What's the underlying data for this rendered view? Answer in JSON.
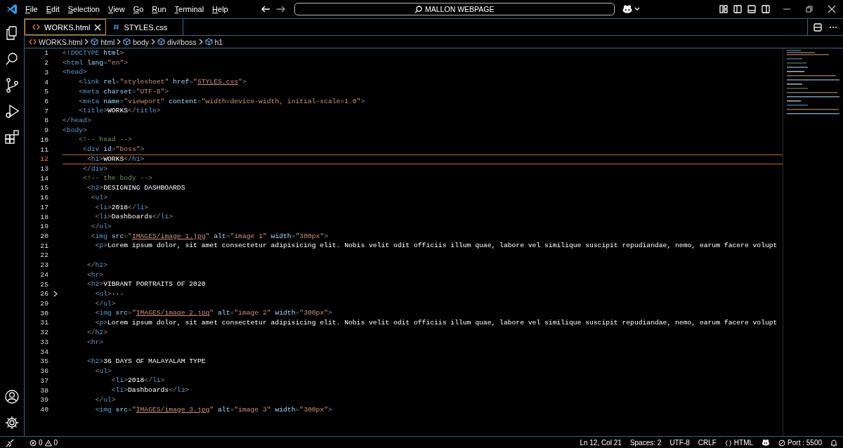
{
  "menu": [
    "File",
    "Edit",
    "Selection",
    "View",
    "Go",
    "Run",
    "Terminal",
    "Help"
  ],
  "search": {
    "value": "MALLON WEBPAGE"
  },
  "tabs": [
    {
      "label": "WORKS.html",
      "kind": "html",
      "selected": true
    },
    {
      "label": "STYLES.css",
      "kind": "css",
      "selected": false
    }
  ],
  "breadcrumb": [
    {
      "label": "WORKS.html",
      "kind": "file"
    },
    {
      "label": "html",
      "kind": "element"
    },
    {
      "label": "body",
      "kind": "element"
    },
    {
      "label": "div#boss",
      "kind": "element"
    },
    {
      "label": "h1",
      "kind": "element"
    }
  ],
  "lines": [
    {
      "number": "1",
      "current": false,
      "folded": false,
      "tokens": [
        {
          "kind": "p",
          "text": "<!"
        },
        {
          "kind": "t",
          "text": "DOCTYPE"
        },
        {
          "kind": "a",
          "text": " html"
        },
        {
          "kind": "p",
          "text": ">"
        }
      ]
    },
    {
      "number": "2",
      "current": false,
      "folded": false,
      "tokens": [
        {
          "kind": "p",
          "text": "<"
        },
        {
          "kind": "t",
          "text": "html"
        },
        {
          "kind": "a",
          "text": " lang"
        },
        {
          "kind": "p",
          "text": "="
        },
        {
          "kind": "s",
          "text": "\"en\""
        },
        {
          "kind": "p",
          "text": ">"
        }
      ]
    },
    {
      "number": "3",
      "current": false,
      "folded": false,
      "tokens": [
        {
          "kind": "p",
          "text": "<"
        },
        {
          "kind": "t",
          "text": "head"
        },
        {
          "kind": "p",
          "text": ">"
        }
      ]
    },
    {
      "number": "4",
      "current": false,
      "folded": false,
      "tokens": [
        {
          "kind": "p",
          "text": "    <"
        },
        {
          "kind": "t",
          "text": "link"
        },
        {
          "kind": "a",
          "text": " rel"
        },
        {
          "kind": "p",
          "text": "="
        },
        {
          "kind": "s",
          "text": "\"stylesheet\""
        },
        {
          "kind": "a",
          "text": " href"
        },
        {
          "kind": "p",
          "text": "="
        },
        {
          "kind": "s",
          "text": "\""
        },
        {
          "kind": "u",
          "text": "STYLES.css"
        },
        {
          "kind": "s",
          "text": "\""
        },
        {
          "kind": "p",
          "text": ">"
        }
      ]
    },
    {
      "number": "5",
      "current": false,
      "folded": false,
      "tokens": [
        {
          "kind": "p",
          "text": "    <"
        },
        {
          "kind": "t",
          "text": "meta"
        },
        {
          "kind": "a",
          "text": " charset"
        },
        {
          "kind": "p",
          "text": "="
        },
        {
          "kind": "s",
          "text": "\"UTF-8\""
        },
        {
          "kind": "p",
          "text": ">"
        }
      ]
    },
    {
      "number": "6",
      "current": false,
      "folded": false,
      "tokens": [
        {
          "kind": "p",
          "text": "    <"
        },
        {
          "kind": "t",
          "text": "meta"
        },
        {
          "kind": "a",
          "text": " name"
        },
        {
          "kind": "p",
          "text": "="
        },
        {
          "kind": "s",
          "text": "\"viewport\""
        },
        {
          "kind": "a",
          "text": " content"
        },
        {
          "kind": "p",
          "text": "="
        },
        {
          "kind": "s",
          "text": "\"width=device-width, initial-scale=1.0\""
        },
        {
          "kind": "p",
          "text": ">"
        }
      ]
    },
    {
      "number": "7",
      "current": false,
      "folded": false,
      "tokens": [
        {
          "kind": "p",
          "text": "    <"
        },
        {
          "kind": "t",
          "text": "title"
        },
        {
          "kind": "p",
          "text": ">"
        },
        {
          "kind": "x",
          "text": "WORKS"
        },
        {
          "kind": "p",
          "text": "</"
        },
        {
          "kind": "t",
          "text": "title"
        },
        {
          "kind": "p",
          "text": ">"
        }
      ]
    },
    {
      "number": "8",
      "current": false,
      "folded": false,
      "tokens": [
        {
          "kind": "p",
          "text": "</"
        },
        {
          "kind": "t",
          "text": "head"
        },
        {
          "kind": "p",
          "text": ">"
        }
      ]
    },
    {
      "number": "9",
      "current": false,
      "folded": false,
      "tokens": [
        {
          "kind": "p",
          "text": "<"
        },
        {
          "kind": "t",
          "text": "body"
        },
        {
          "kind": "p",
          "text": ">"
        }
      ]
    },
    {
      "number": "10",
      "current": false,
      "folded": false,
      "tokens": [
        {
          "kind": "c",
          "text": "    <!-- head -->"
        }
      ]
    },
    {
      "number": "11",
      "current": false,
      "folded": false,
      "tokens": [
        {
          "kind": "p",
          "text": "     <"
        },
        {
          "kind": "t",
          "text": "div"
        },
        {
          "kind": "a",
          "text": " id"
        },
        {
          "kind": "p",
          "text": "="
        },
        {
          "kind": "s",
          "text": "\"boss\""
        },
        {
          "kind": "p",
          "text": ">"
        }
      ]
    },
    {
      "number": "12",
      "current": true,
      "folded": false,
      "tokens": [
        {
          "kind": "p",
          "text": "      <"
        },
        {
          "kind": "t",
          "text": "h1"
        },
        {
          "kind": "p",
          "text": ">"
        },
        {
          "kind": "x",
          "text": "WORKS"
        },
        {
          "kind": "p",
          "text": "</"
        },
        {
          "kind": "t",
          "text": "h1"
        },
        {
          "kind": "p",
          "text": ">"
        }
      ]
    },
    {
      "number": "13",
      "current": false,
      "folded": false,
      "tokens": [
        {
          "kind": "p",
          "text": "     </"
        },
        {
          "kind": "t",
          "text": "div"
        },
        {
          "kind": "p",
          "text": ">"
        }
      ]
    },
    {
      "number": "14",
      "current": false,
      "folded": false,
      "tokens": [
        {
          "kind": "c",
          "text": "     <!-- the body -->"
        }
      ]
    },
    {
      "number": "15",
      "current": false,
      "folded": false,
      "tokens": [
        {
          "kind": "p",
          "text": "      <"
        },
        {
          "kind": "t",
          "text": "h2"
        },
        {
          "kind": "p",
          "text": ">"
        },
        {
          "kind": "x",
          "text": "DESIGNING DASHBOARDS"
        }
      ]
    },
    {
      "number": "16",
      "current": false,
      "folded": false,
      "tokens": [
        {
          "kind": "p",
          "text": "       <"
        },
        {
          "kind": "t",
          "text": "ul"
        },
        {
          "kind": "p",
          "text": ">"
        }
      ]
    },
    {
      "number": "17",
      "current": false,
      "folded": false,
      "tokens": [
        {
          "kind": "p",
          "text": "        <"
        },
        {
          "kind": "t",
          "text": "li"
        },
        {
          "kind": "p",
          "text": ">"
        },
        {
          "kind": "x",
          "text": "2018"
        },
        {
          "kind": "p",
          "text": "</"
        },
        {
          "kind": "t",
          "text": "li"
        },
        {
          "kind": "p",
          "text": ">"
        }
      ]
    },
    {
      "number": "18",
      "current": false,
      "folded": false,
      "tokens": [
        {
          "kind": "p",
          "text": "        <"
        },
        {
          "kind": "t",
          "text": "li"
        },
        {
          "kind": "p",
          "text": ">"
        },
        {
          "kind": "x",
          "text": "Dashboards"
        },
        {
          "kind": "p",
          "text": "</"
        },
        {
          "kind": "t",
          "text": "li"
        },
        {
          "kind": "p",
          "text": ">"
        }
      ]
    },
    {
      "number": "19",
      "current": false,
      "folded": false,
      "tokens": [
        {
          "kind": "p",
          "text": "       </"
        },
        {
          "kind": "t",
          "text": "ul"
        },
        {
          "kind": "p",
          "text": ">"
        }
      ]
    },
    {
      "number": "20",
      "current": false,
      "folded": false,
      "tokens": [
        {
          "kind": "p",
          "text": "       <"
        },
        {
          "kind": "t",
          "text": "img"
        },
        {
          "kind": "a",
          "text": " src"
        },
        {
          "kind": "p",
          "text": "="
        },
        {
          "kind": "s",
          "text": "\""
        },
        {
          "kind": "u",
          "text": "IMAGES/image 1.jpg"
        },
        {
          "kind": "s",
          "text": "\""
        },
        {
          "kind": "a",
          "text": " alt"
        },
        {
          "kind": "p",
          "text": "="
        },
        {
          "kind": "s",
          "text": "\"image 1\""
        },
        {
          "kind": "a",
          "text": " width"
        },
        {
          "kind": "p",
          "text": "="
        },
        {
          "kind": "s",
          "text": "\"300px\""
        },
        {
          "kind": "p",
          "text": ">"
        }
      ]
    },
    {
      "number": "21",
      "current": false,
      "folded": false,
      "tokens": [
        {
          "kind": "p",
          "text": "        <"
        },
        {
          "kind": "t",
          "text": "p"
        },
        {
          "kind": "p",
          "text": ">"
        },
        {
          "kind": "x",
          "text": "Lorem ipsum dolor, sit amet consectetur adipisicing elit. Nobis velit odit officiis illum quae, labore vel similique suscipit repudiandae, nemo, earum facere volupt"
        }
      ]
    },
    {
      "number": "22",
      "current": false,
      "folded": false
    },
    {
      "number": "23",
      "current": false,
      "folded": false,
      "tokens": [
        {
          "kind": "p",
          "text": "      </"
        },
        {
          "kind": "t",
          "text": "h2"
        },
        {
          "kind": "p",
          "text": ">"
        }
      ]
    },
    {
      "number": "24",
      "current": false,
      "folded": false,
      "tokens": [
        {
          "kind": "p",
          "text": "      <"
        },
        {
          "kind": "t",
          "text": "hr"
        },
        {
          "kind": "p",
          "text": ">"
        }
      ]
    },
    {
      "number": "25",
      "current": false,
      "folded": false,
      "tokens": [
        {
          "kind": "p",
          "text": "      <"
        },
        {
          "kind": "t",
          "text": "h2"
        },
        {
          "kind": "p",
          "text": ">"
        },
        {
          "kind": "x",
          "text": "VIBRANT PORTRAITS OF 2020"
        }
      ]
    },
    {
      "number": "26",
      "current": false,
      "folded": true,
      "tokens": [
        {
          "kind": "p",
          "text": "        <"
        },
        {
          "kind": "t",
          "text": "ul"
        },
        {
          "kind": "p",
          "text": ">"
        },
        {
          "kind": "x",
          "text": "···"
        }
      ]
    },
    {
      "number": "29",
      "current": false,
      "folded": false,
      "tokens": [
        {
          "kind": "p",
          "text": "        </"
        },
        {
          "kind": "t",
          "text": "ul"
        },
        {
          "kind": "p",
          "text": ">"
        }
      ]
    },
    {
      "number": "30",
      "current": false,
      "folded": false,
      "tokens": [
        {
          "kind": "p",
          "text": "        <"
        },
        {
          "kind": "t",
          "text": "img"
        },
        {
          "kind": "a",
          "text": " src"
        },
        {
          "kind": "p",
          "text": "="
        },
        {
          "kind": "s",
          "text": "\""
        },
        {
          "kind": "u",
          "text": "IMAGES/image 2.jpg"
        },
        {
          "kind": "s",
          "text": "\""
        },
        {
          "kind": "a",
          "text": " alt"
        },
        {
          "kind": "p",
          "text": "="
        },
        {
          "kind": "s",
          "text": "\"image 2\""
        },
        {
          "kind": "a",
          "text": " width"
        },
        {
          "kind": "p",
          "text": "="
        },
        {
          "kind": "s",
          "text": "\"300px\""
        },
        {
          "kind": "p",
          "text": ">"
        }
      ]
    },
    {
      "number": "31",
      "current": false,
      "folded": false,
      "tokens": [
        {
          "kind": "p",
          "text": "        <"
        },
        {
          "kind": "t",
          "text": "p"
        },
        {
          "kind": "p",
          "text": ">"
        },
        {
          "kind": "x",
          "text": "Lorem ipsum dolor, sit amet consectetur adipisicing elit. Nobis velit odit officiis illum quae, labore vel similique suscipit repudiandae, nemo, earum facere volupt"
        }
      ]
    },
    {
      "number": "32",
      "current": false,
      "folded": false,
      "tokens": [
        {
          "kind": "p",
          "text": "      </"
        },
        {
          "kind": "t",
          "text": "h2"
        },
        {
          "kind": "p",
          "text": ">"
        }
      ]
    },
    {
      "number": "33",
      "current": false,
      "folded": false,
      "tokens": [
        {
          "kind": "p",
          "text": "      <"
        },
        {
          "kind": "t",
          "text": "hr"
        },
        {
          "kind": "p",
          "text": ">"
        }
      ]
    },
    {
      "number": "34",
      "current": false,
      "folded": false
    },
    {
      "number": "35",
      "current": false,
      "folded": false,
      "tokens": [
        {
          "kind": "p",
          "text": "      <"
        },
        {
          "kind": "t",
          "text": "h2"
        },
        {
          "kind": "p",
          "text": ">"
        },
        {
          "kind": "x",
          "text": "36 DAYS OF MALAYALAM TYPE"
        }
      ]
    },
    {
      "number": "36",
      "current": false,
      "folded": false,
      "tokens": [
        {
          "kind": "p",
          "text": "        <"
        },
        {
          "kind": "t",
          "text": "ul"
        },
        {
          "kind": "p",
          "text": ">"
        }
      ]
    },
    {
      "number": "37",
      "current": false,
      "folded": false,
      "tokens": [
        {
          "kind": "p",
          "text": "            <"
        },
        {
          "kind": "t",
          "text": "li"
        },
        {
          "kind": "p",
          "text": ">"
        },
        {
          "kind": "x",
          "text": "2018"
        },
        {
          "kind": "p",
          "text": "</"
        },
        {
          "kind": "t",
          "text": "li"
        },
        {
          "kind": "p",
          "text": ">"
        }
      ]
    },
    {
      "number": "38",
      "current": false,
      "folded": false,
      "tokens": [
        {
          "kind": "p",
          "text": "            <"
        },
        {
          "kind": "t",
          "text": "li"
        },
        {
          "kind": "p",
          "text": ">"
        },
        {
          "kind": "x",
          "text": "Dashboards"
        },
        {
          "kind": "p",
          "text": "</"
        },
        {
          "kind": "t",
          "text": "li"
        },
        {
          "kind": "p",
          "text": ">"
        }
      ]
    },
    {
      "number": "39",
      "current": false,
      "folded": false,
      "tokens": [
        {
          "kind": "p",
          "text": "        </"
        },
        {
          "kind": "t",
          "text": "ul"
        },
        {
          "kind": "p",
          "text": ">"
        }
      ]
    },
    {
      "number": "40",
      "current": false,
      "folded": false,
      "tokens": [
        {
          "kind": "p",
          "text": "        <"
        },
        {
          "kind": "t",
          "text": "img"
        },
        {
          "kind": "a",
          "text": " src"
        },
        {
          "kind": "p",
          "text": "="
        },
        {
          "kind": "s",
          "text": "\""
        },
        {
          "kind": "u",
          "text": "IMAGES/image 3.jpg"
        },
        {
          "kind": "s",
          "text": "\""
        },
        {
          "kind": "a",
          "text": " alt"
        },
        {
          "kind": "p",
          "text": "="
        },
        {
          "kind": "s",
          "text": "\"image 3\""
        },
        {
          "kind": "a",
          "text": " width"
        },
        {
          "kind": "p",
          "text": "="
        },
        {
          "kind": "s",
          "text": "\"300px\""
        },
        {
          "kind": "p",
          "text": ">"
        }
      ]
    }
  ],
  "status_bar": {
    "errors": "0",
    "warnings": "0",
    "position": "Ln 12, Col 21",
    "spaces": "Spaces: 2",
    "encoding": "UTF-8",
    "line_ending": "CRLF",
    "language": "HTML",
    "port": "Port : 5500"
  }
}
